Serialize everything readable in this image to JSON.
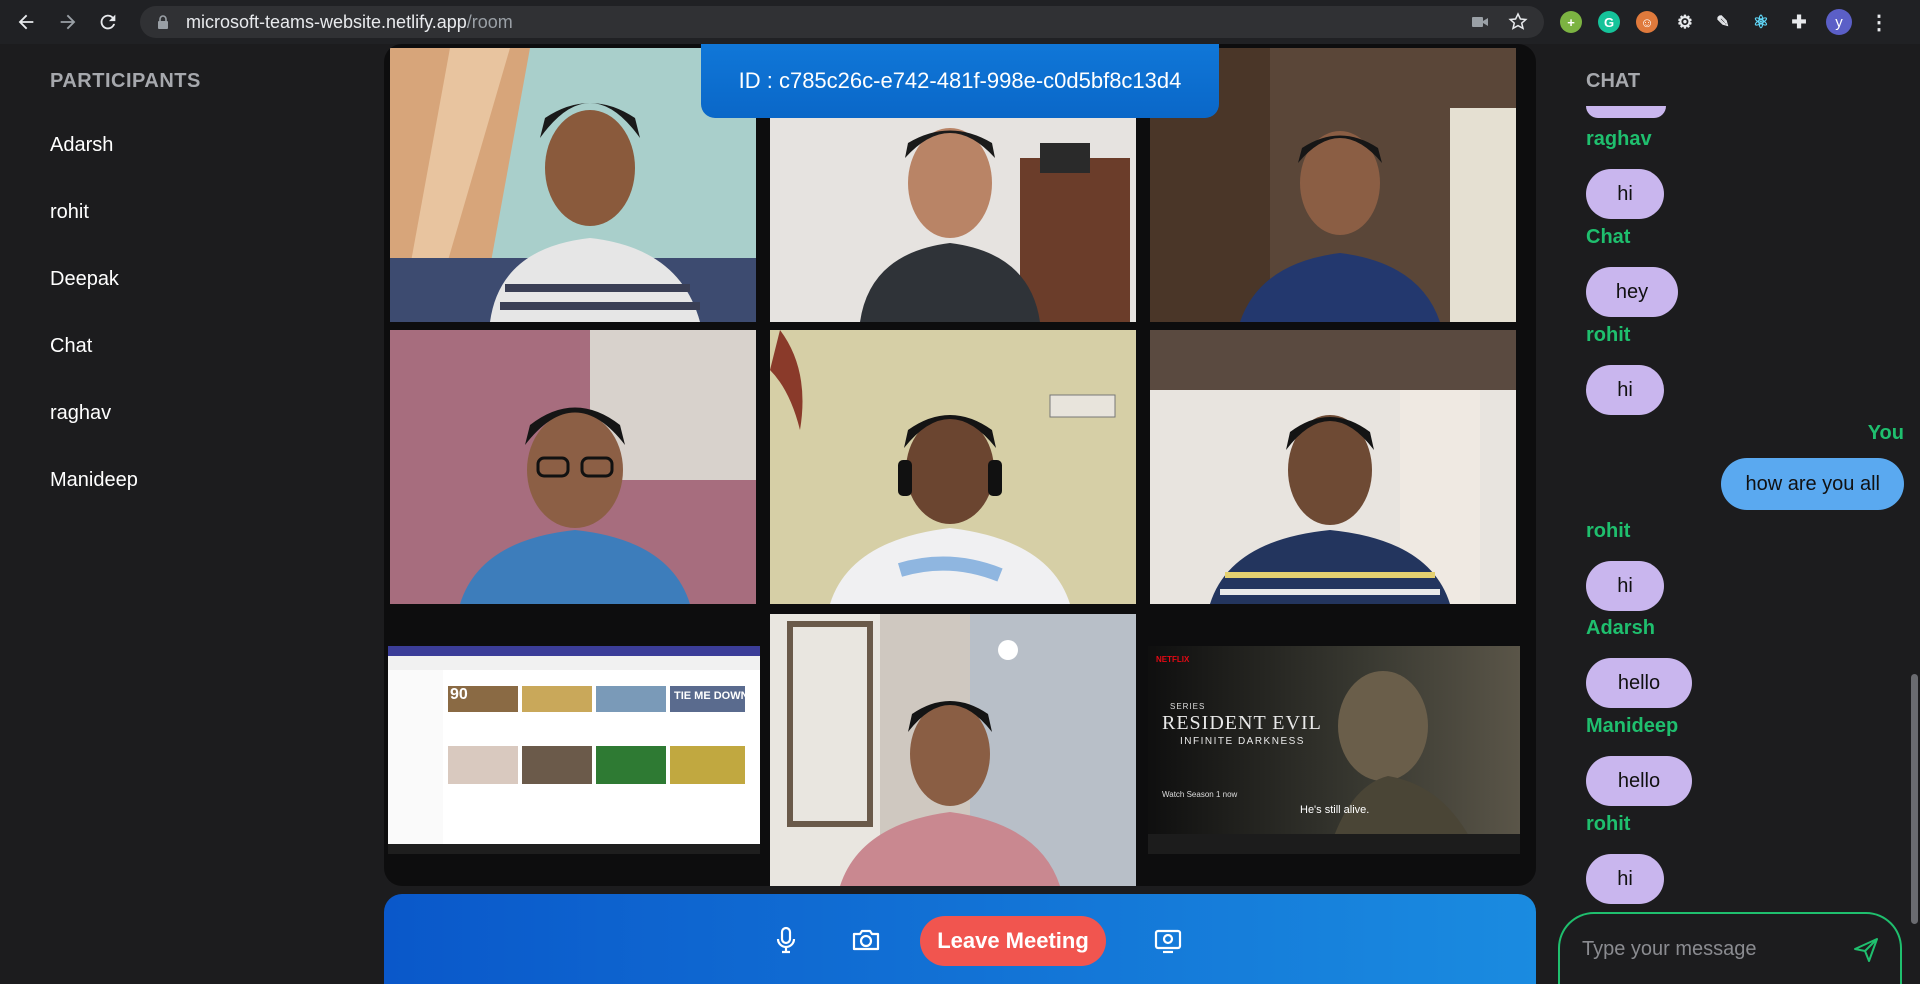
{
  "browser": {
    "url_host": "microsoft-teams-website.netlify.app",
    "url_path": "/room",
    "profile_initial": "y"
  },
  "participants_panel": {
    "heading": "PARTICIPANTS",
    "participants": [
      "Adarsh",
      "rohit",
      "Deepak",
      "Chat",
      "raghav",
      "Manideep"
    ]
  },
  "room": {
    "id_text": "ID : c785c26c-e742-481f-998e-c0d5bf8c13d4"
  },
  "video_tiles": [
    {
      "type": "camera",
      "bg": "#8fbfbf"
    },
    {
      "type": "camera",
      "bg": "#d9d4cf"
    },
    {
      "type": "camera",
      "bg": "#6a5a4c"
    },
    {
      "type": "camera",
      "bg": "#9a6a78"
    },
    {
      "type": "camera",
      "bg": "#cfc7a8"
    },
    {
      "type": "camera",
      "bg": "#b4aaa0"
    },
    {
      "type": "screen-youtube",
      "bg": "#ffffff"
    },
    {
      "type": "camera",
      "bg": "#b8a79a"
    },
    {
      "type": "screen-netflix",
      "bg": "#1a1a1a"
    }
  ],
  "screen_share_netflix": {
    "title_line1": "RESIDENT EVIL",
    "title_line2": "INFINITE DARKNESS",
    "series_tag": "SERIES",
    "subtitle": "He's still alive.",
    "watch_text": "Watch Season 1 now"
  },
  "screen_share_youtube": {
    "thumb_texts": [
      "90",
      "TIE ME DOWN"
    ]
  },
  "controls": {
    "leave_label": "Leave Meeting",
    "mic_icon": "microphone-icon",
    "camera_icon": "camera-icon",
    "screen_icon": "screen-share-icon"
  },
  "chat": {
    "heading": "CHAT",
    "messages": [
      {
        "sender": "raghav",
        "text": "hi",
        "self": false
      },
      {
        "sender": "Chat",
        "text": "hey",
        "self": false
      },
      {
        "sender": "rohit",
        "text": "hi",
        "self": false
      },
      {
        "sender": "You",
        "text": "how are you all",
        "self": true
      },
      {
        "sender": "rohit",
        "text": "hi",
        "self": false
      },
      {
        "sender": "Adarsh",
        "text": "hello",
        "self": false
      },
      {
        "sender": "Manideep",
        "text": "hello",
        "self": false
      },
      {
        "sender": "rohit",
        "text": "hi",
        "self": false
      }
    ],
    "input_placeholder": "Type your message"
  },
  "colors": {
    "accent_blue": "#0a67c8",
    "leave_red": "#f1554f",
    "sender_green": "#1fbf6e",
    "bubble_purple": "#c9b6ee",
    "bubble_self_blue": "#5aa9f0"
  }
}
